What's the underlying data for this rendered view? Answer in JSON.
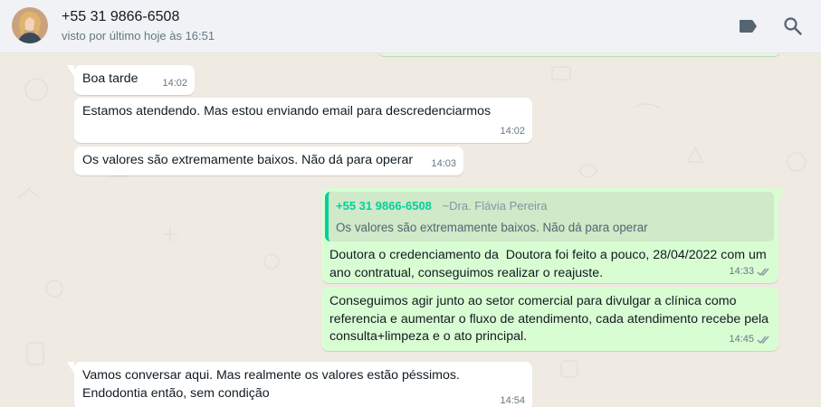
{
  "header": {
    "contact_name": "+55 31 9866-6508",
    "status": "visto por último hoje às 16:51"
  },
  "icons": {
    "label": "label-icon",
    "search": "search-icon"
  },
  "colors": {
    "incoming_bubble": "#ffffff",
    "outgoing_bubble": "#d9fdd3",
    "accent": "#06cf9c",
    "chat_background": "#efeae2",
    "read_ticks": "#8696a0"
  },
  "messages": [
    {
      "direction": "in",
      "text": "Boa tarde",
      "time": "14:02"
    },
    {
      "direction": "in",
      "text": "Estamos atendendo. Mas estou enviando email para descredenciarmos",
      "time": "14:02"
    },
    {
      "direction": "in",
      "text": "Os valores são extremamente baixos. Não dá para operar",
      "time": "14:03"
    },
    {
      "direction": "out",
      "quoted": {
        "phone": "+55 31 9866-6508",
        "alias": "~Dra. Flávia Pereira",
        "text": "Os valores são extremamente baixos. Não dá para operar"
      }
    },
    {
      "direction": "out",
      "text": "Doutora o credenciamento da  Doutora foi feito a pouco, 28/04/2022 com um ano contratual, conseguimos realizar o reajuste.",
      "time": "14:33",
      "status": "read"
    },
    {
      "direction": "out",
      "text": "Conseguimos agir junto ao setor comercial para divulgar a clínica como referencia e aumentar o fluxo de atendimento, cada atendimento recebe pela consulta+limpeza e o ato principal.",
      "time": "14:45",
      "status": "read"
    },
    {
      "direction": "in",
      "text": "Vamos conversar aqui. Mas realmente os valores estão péssimos. Endodontia então, sem condição",
      "time": "14:54"
    }
  ]
}
